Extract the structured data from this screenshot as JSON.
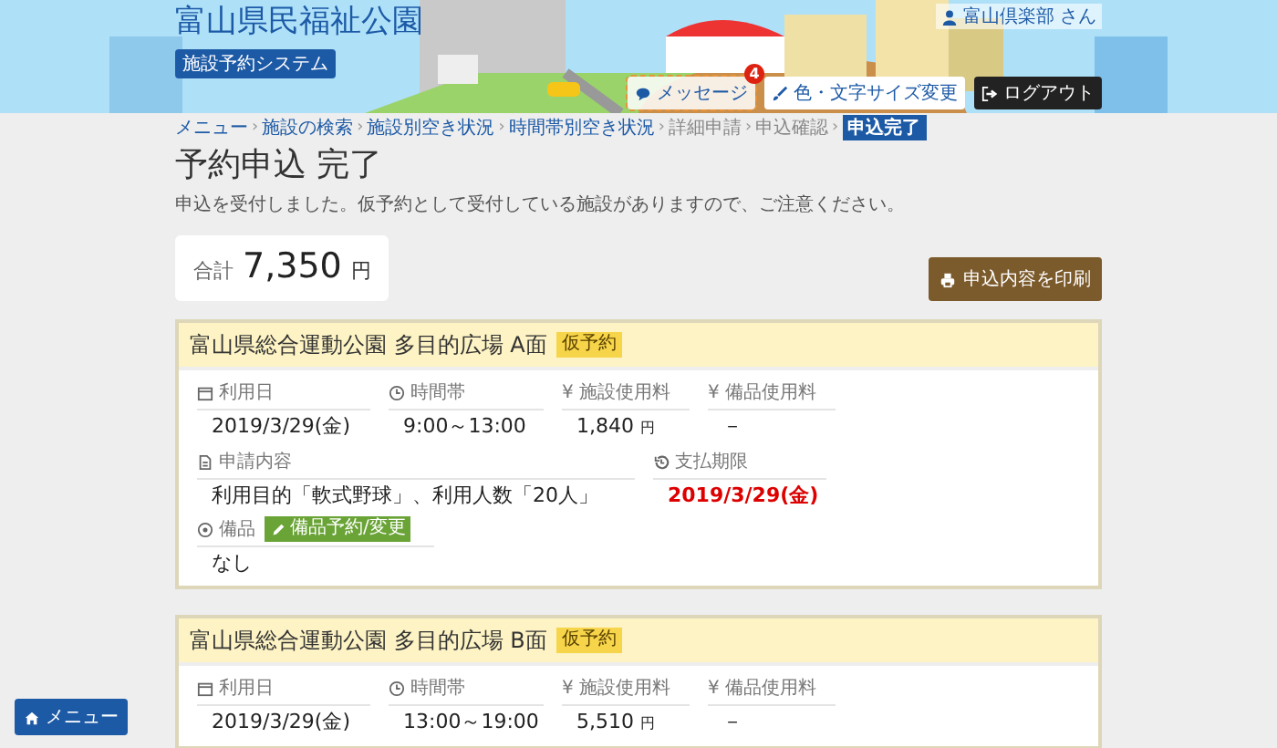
{
  "header": {
    "site_title": "富山県民福祉公園",
    "system_badge": "施設予約システム",
    "user": "富山倶楽部 さん",
    "buttons": [
      {
        "kind": "message",
        "label": "メッセージ",
        "badge": "4"
      },
      {
        "kind": "style",
        "label": "色・文字サイズ変更"
      },
      {
        "kind": "logout",
        "label": "ログアウト"
      }
    ]
  },
  "breadcrumb": {
    "separator": "›",
    "items": [
      {
        "label": "メニュー",
        "link": true,
        "selected": false
      },
      {
        "label": "施設の検索",
        "link": true,
        "selected": false
      },
      {
        "label": "施設別空き状況",
        "link": true,
        "selected": false
      },
      {
        "label": "時間帯別空き状況",
        "link": true,
        "selected": false
      },
      {
        "label": "詳細申請",
        "link": false,
        "selected": false
      },
      {
        "label": "申込確認",
        "link": false,
        "selected": false
      },
      {
        "label": "申込完了",
        "link": false,
        "selected": true
      }
    ]
  },
  "page": {
    "title": "予約申込 完了",
    "notice": "申込を受付しました。仮予約として受付している施設がありますので、ご注意ください。"
  },
  "total": {
    "label": "合計",
    "amount": "7,350",
    "unit": "円"
  },
  "print_button": "申込内容を印刷",
  "reservations": [
    {
      "facility": "富山県総合運動公園 多目的広場 A面",
      "status": "仮予約",
      "rows": [
        {
          "fields": [
            {
              "kind": "date",
              "label": "利用日",
              "value": "2019/3/29(金)"
            },
            {
              "kind": "time",
              "label": "時間帯",
              "value": "9:00～13:00"
            },
            {
              "kind": "fee",
              "label": "¥ 施設使用料",
              "value": "1,840",
              "unit": "円"
            },
            {
              "kind": "fee",
              "label": "¥ 備品使用料",
              "value": "－"
            }
          ]
        },
        {
          "fields": [
            {
              "kind": "content",
              "label": "申請内容",
              "value": "利用目的「軟式野球」、利用人数「20人」"
            },
            {
              "kind": "deadline",
              "label": "支払期限",
              "value": "2019/3/29(金)"
            }
          ]
        },
        {
          "fields": [
            {
              "kind": "equipment",
              "label": "備品",
              "button": "備品予約/変更",
              "value": "なし"
            }
          ]
        }
      ]
    },
    {
      "facility": "富山県総合運動公園 多目的広場 B面",
      "status": "仮予約",
      "rows": [
        {
          "fields": [
            {
              "kind": "date",
              "label": "利用日",
              "value": "2019/3/29(金)"
            },
            {
              "kind": "time",
              "label": "時間帯",
              "value": "13:00～19:00"
            },
            {
              "kind": "fee",
              "label": "¥ 施設使用料",
              "value": "5,510",
              "unit": "円"
            },
            {
              "kind": "fee",
              "label": "¥ 備品使用料",
              "value": "－"
            }
          ]
        }
      ]
    }
  ],
  "menu_button": "メニュー"
}
